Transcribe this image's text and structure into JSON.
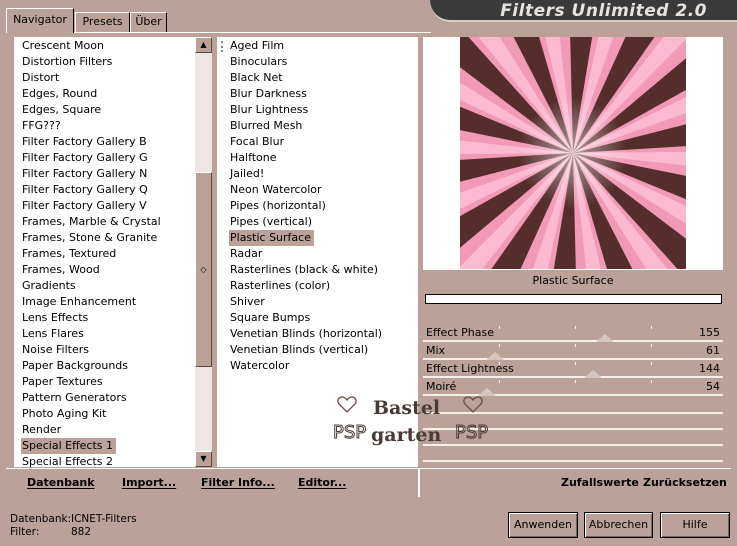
{
  "tabs": [
    {
      "label": "Navigator",
      "active": true
    },
    {
      "label": "Presets",
      "active": false
    },
    {
      "label": "Über",
      "active": false
    }
  ],
  "title": "Filters Unlimited 2.0",
  "categories": [
    "Crescent Moon",
    "Distortion Filters",
    "Distort",
    "Edges, Round",
    "Edges, Square",
    "FFG???",
    "Filter Factory Gallery B",
    "Filter Factory Gallery G",
    "Filter Factory Gallery N",
    "Filter Factory Gallery Q",
    "Filter Factory Gallery V",
    "Frames, Marble & Crystal",
    "Frames, Stone & Granite",
    "Frames, Textured",
    "Frames, Wood",
    "Gradients",
    "Image Enhancement",
    "Lens Effects",
    "Lens Flares",
    "Noise Filters",
    "Paper Backgrounds",
    "Paper Textures",
    "Pattern Generators",
    "Photo Aging Kit",
    "Render",
    "Special Effects 1",
    "Special Effects 2"
  ],
  "selected_category": "Special Effects 1",
  "filters": [
    "Aged Film",
    "Binoculars",
    "Black Net",
    "Blur Darkness",
    "Blur Lightness",
    "Blurred Mesh",
    "Focal Blur",
    "Halftone",
    "Jailed!",
    "Neon Watercolor",
    "Pipes (horizontal)",
    "Pipes (vertical)",
    "Plastic Surface",
    "Radar",
    "Rasterlines (black & white)",
    "Rasterlines (color)",
    "Shiver",
    "Square Bumps",
    "Venetian Blinds (horizontal)",
    "Venetian Blinds (vertical)",
    "Watercolor"
  ],
  "selected_filter": "Plastic Surface",
  "preview_filter_name": "Plastic Surface",
  "parameters": [
    {
      "label": "Effect Phase",
      "value": 155,
      "fraction": 0.608
    },
    {
      "label": "Mix",
      "value": 61,
      "fraction": 0.239
    },
    {
      "label": "Effect Lightness",
      "value": 144,
      "fraction": 0.565
    },
    {
      "label": "Moiré",
      "value": 54,
      "fraction": 0.212
    }
  ],
  "watermark": {
    "line1": "Bastel",
    "line2": "garten",
    "logo": "PSP"
  },
  "toolbar": {
    "database": "Datenbank",
    "import": "Import...",
    "filter_info": "Filter Info...",
    "editor": "Editor...",
    "random": "Zufallswerte",
    "reset": "Zurücksetzen"
  },
  "status": {
    "db_label": "Datenbank:",
    "db_value": "ICNET-Filters",
    "filter_label": "Filter:",
    "filter_value": "882"
  },
  "buttons": {
    "apply": "Anwenden",
    "cancel": "Abbrechen",
    "help": "Hilfe"
  },
  "colors": {
    "panel_bg": "#bba198",
    "selection": "#bba198",
    "title_bar": "#3a3a3a",
    "preview_pink": "#f19ab8",
    "preview_dark": "#3a1a14"
  }
}
